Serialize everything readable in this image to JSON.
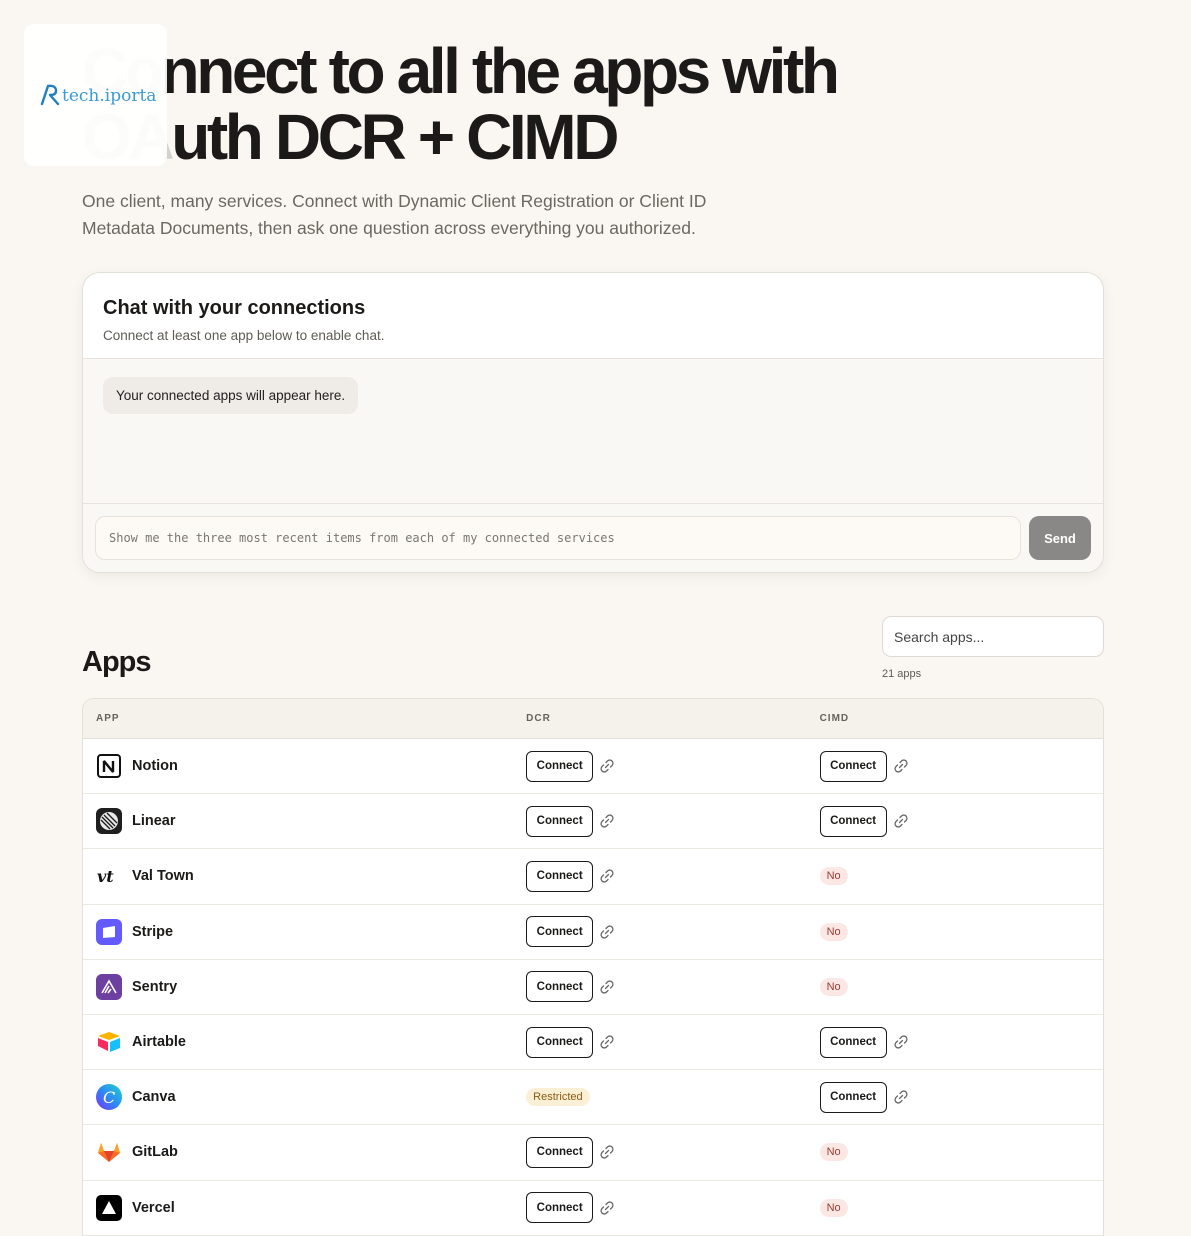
{
  "logo": {
    "text": "tech.iportal"
  },
  "hero": {
    "title_line1_a": "Co",
    "title_line1_b": "nnect to all the apps with",
    "title_line2_a": "OA",
    "title_line2_b": "uth DCR + CIMD",
    "subtitle": "One client, many services. Connect with Dynamic Client Registration or Client ID Metadata Documents, then ask one question across everything you authorized."
  },
  "chat": {
    "title": "Chat with your connections",
    "description": "Connect at least one app below to enable chat.",
    "empty_message": "Your connected apps will appear here.",
    "input_placeholder": "Show me the three most recent items from each of my connected services",
    "send_label": "Send"
  },
  "apps": {
    "title": "Apps",
    "search_placeholder": "Search apps...",
    "count_label": "21 apps",
    "columns": {
      "app": "APP",
      "dcr": "DCR",
      "cimd": "CIMD"
    },
    "connect_label": "Connect",
    "no_label": "No",
    "restricted_label": "Restricted",
    "rows": [
      {
        "name": "Notion",
        "icon": "notion-icon",
        "dcr": "connect",
        "cimd": "connect"
      },
      {
        "name": "Linear",
        "icon": "linear-icon",
        "dcr": "connect",
        "cimd": "connect"
      },
      {
        "name": "Val Town",
        "icon": "valtown-icon",
        "dcr": "connect",
        "cimd": "no"
      },
      {
        "name": "Stripe",
        "icon": "stripe-icon",
        "dcr": "connect",
        "cimd": "no"
      },
      {
        "name": "Sentry",
        "icon": "sentry-icon",
        "dcr": "connect",
        "cimd": "no"
      },
      {
        "name": "Airtable",
        "icon": "airtable-icon",
        "dcr": "connect",
        "cimd": "connect"
      },
      {
        "name": "Canva",
        "icon": "canva-icon",
        "dcr": "restricted",
        "cimd": "connect"
      },
      {
        "name": "GitLab",
        "icon": "gitlab-icon",
        "dcr": "connect",
        "cimd": "no"
      },
      {
        "name": "Vercel",
        "icon": "vercel-icon",
        "dcr": "connect",
        "cimd": "no"
      }
    ]
  }
}
